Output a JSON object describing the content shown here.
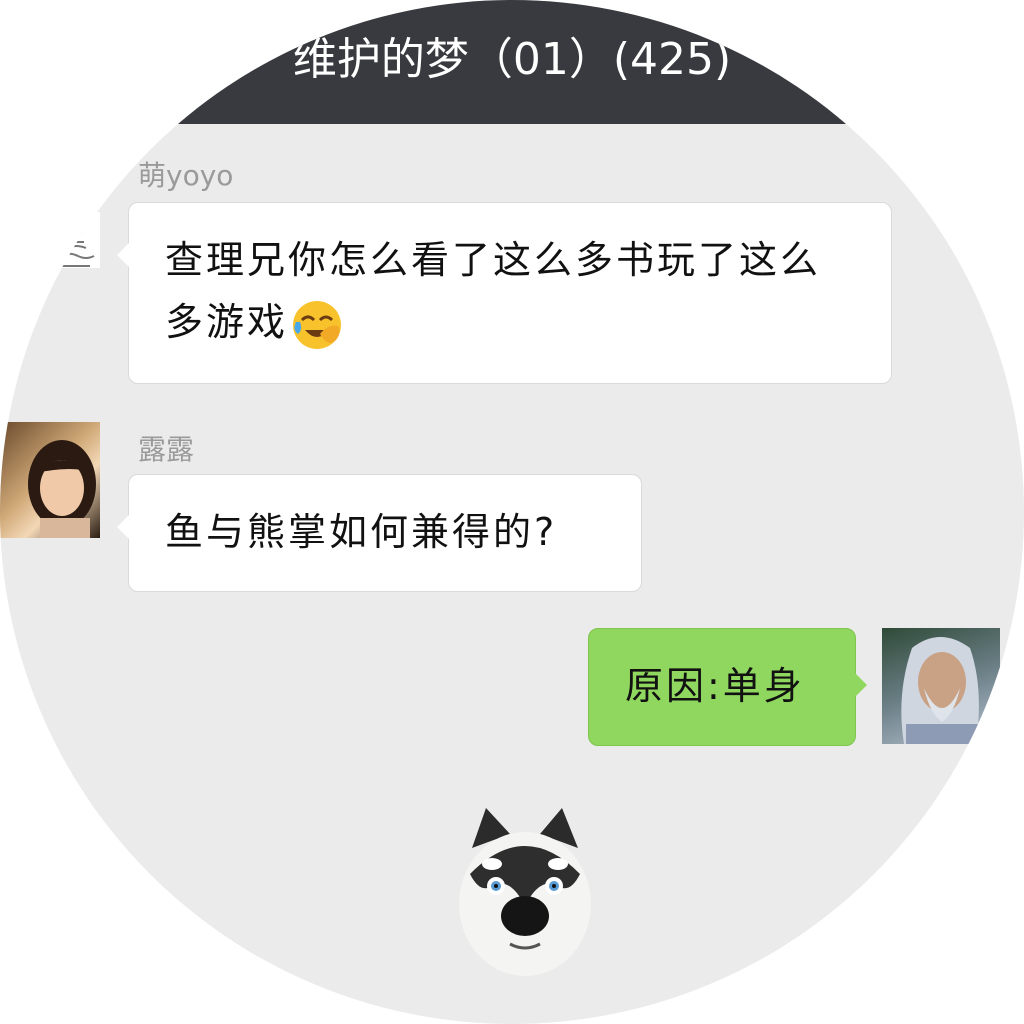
{
  "chat": {
    "title": "维护的梦（01）(425)",
    "messages": [
      {
        "sender": "萌yoyo",
        "text": "查理兄你怎么看了这么多书玩了这么多游戏",
        "emoji": "face-with-tears-of-joy"
      },
      {
        "sender": "露露",
        "text": "鱼与熊掌如何兼得的?"
      },
      {
        "text": "原因:单身"
      }
    ],
    "sticker": "husky-dog-sticker"
  },
  "colors": {
    "titlebar": "#393a3f",
    "background": "#ebebeb",
    "incoming_bubble": "#ffffff",
    "outgoing_bubble": "#8fd75f",
    "sender_name": "#9a9a9a"
  }
}
